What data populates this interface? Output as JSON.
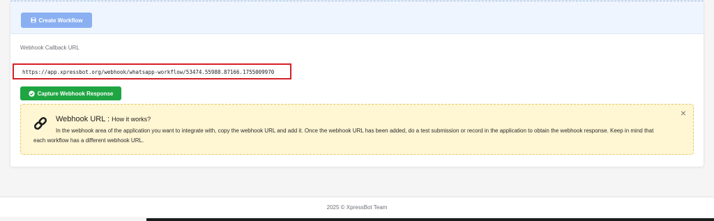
{
  "toolbar": {
    "create_workflow_label": "Create Workflow"
  },
  "webhook": {
    "section_label": "Webhook Callback URL",
    "url": "https://app.xpressbot.org/webhook/whatsapp-workflow/53474.55988.87166.1755009970",
    "capture_label": "Capture Webhook Response"
  },
  "info": {
    "title": "Webhook URL :",
    "subtitle": "How it works?",
    "body_line1": "In the webhook area of the application you want to integrate with, copy the webhook URL and add it. Once the webhook URL has been added, do a test submission or record in the application to obtain the webhook response. Keep in mind that",
    "body_line2": "each workflow has a different webhook URL.",
    "close_glyph": "×"
  },
  "footer": {
    "text": "2025 © XpressBot Team"
  },
  "icons": {
    "save": "save-icon",
    "check_circle": "check-circle-icon",
    "link": "link-icon",
    "close": "close-icon"
  },
  "colors": {
    "create_button": "#8ab0f2",
    "capture_button": "#1fa542",
    "url_highlight": "#d61f26",
    "alert_background": "#fff6d3"
  }
}
